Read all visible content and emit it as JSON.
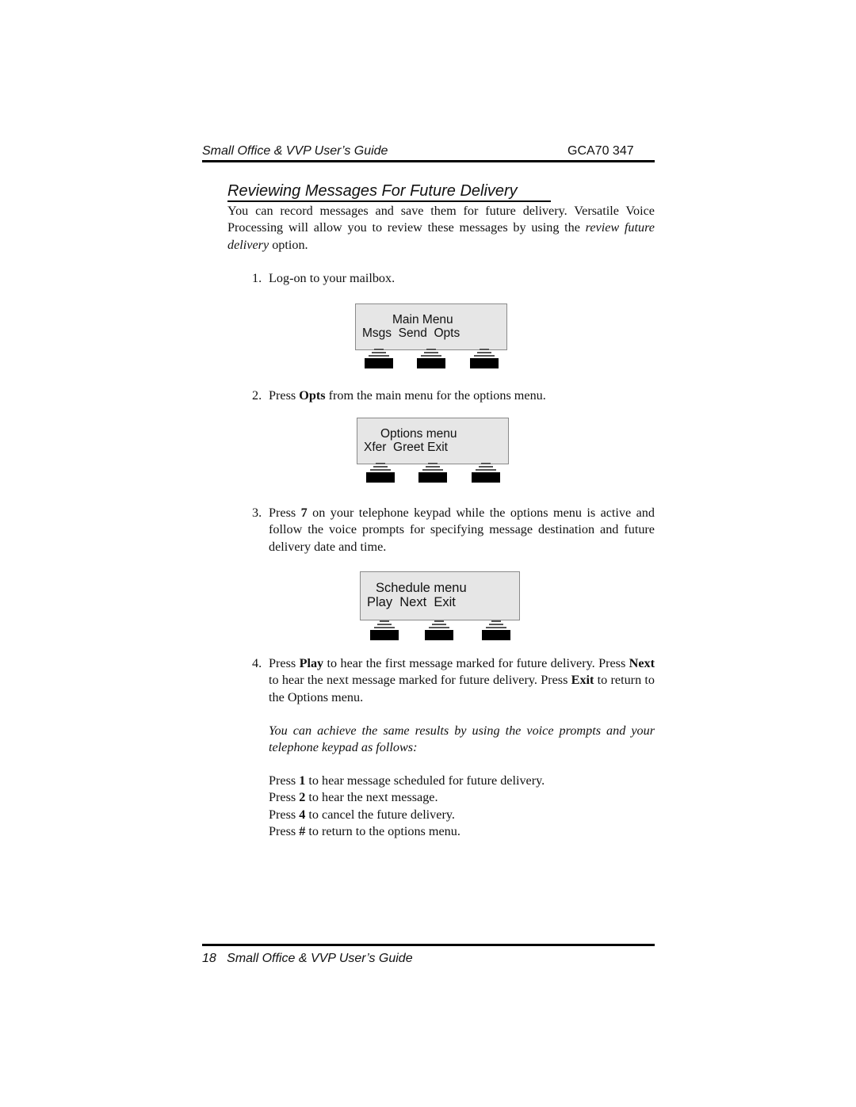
{
  "header": {
    "guide_title": "Small Office & VVP User’s Guide",
    "doc_code": "GCA70 347"
  },
  "section": {
    "title": "Reviewing Messages For Future Delivery"
  },
  "intro": {
    "text_before": "You can record messages and save them for future delivery. Versatile Voice Processing will allow you to review these messages by using the ",
    "emphasis": "review future delivery",
    "text_after": " option."
  },
  "steps": [
    {
      "num": "1.",
      "parts": [
        {
          "t": "Log-on to your mailbox.",
          "b": false
        }
      ]
    },
    {
      "num": "2.",
      "parts": [
        {
          "t": "Press ",
          "b": false
        },
        {
          "t": "Opts",
          "b": true
        },
        {
          "t": " from the main menu for the options menu.",
          "b": false
        }
      ]
    },
    {
      "num": "3.",
      "parts": [
        {
          "t": "Press ",
          "b": false
        },
        {
          "t": "7",
          "b": true
        },
        {
          "t": " on your telephone keypad while the options menu is active and follow the voice prompts for specifying message destination and future delivery date and time.",
          "b": false
        }
      ]
    },
    {
      "num": "4.",
      "parts": [
        {
          "t": "Press ",
          "b": false
        },
        {
          "t": "Play",
          "b": true
        },
        {
          "t": " to hear the first message marked for future delivery. Press ",
          "b": false
        },
        {
          "t": "Next",
          "b": true
        },
        {
          "t": " to hear the next message marked for future delivery. Press ",
          "b": false
        },
        {
          "t": "Exit",
          "b": true
        },
        {
          "t": " to return to the Options menu.",
          "b": false
        }
      ]
    }
  ],
  "displays": {
    "main_menu": {
      "line1": "Main Menu",
      "line2": "Msgs  Send  Opts",
      "softkeys": [
        "Msgs",
        "Send",
        "Opts"
      ]
    },
    "options_menu": {
      "line1": "Options menu",
      "line2": "Xfer  Greet Exit",
      "softkeys": [
        "Xfer",
        "Greet",
        "Exit"
      ]
    },
    "schedule_menu": {
      "line1": "Schedule menu",
      "line2": "Play  Next  Exit",
      "softkeys": [
        "Play",
        "Next",
        "Exit"
      ]
    }
  },
  "alt_note": "You can achieve the same results by using the voice prompts and your telephone keypad as follows:",
  "keypad_instructions": [
    {
      "prefix": "Press ",
      "key": "1",
      "suffix": " to hear message scheduled for future delivery."
    },
    {
      "prefix": "Press ",
      "key": "2",
      "suffix": " to hear the next message."
    },
    {
      "prefix": "Press ",
      "key": "4",
      "suffix": " to cancel the future delivery."
    },
    {
      "prefix": "Press ",
      "key": "#",
      "suffix": " to return to the options menu."
    }
  ],
  "footer": {
    "page_number": "18",
    "guide_title": "Small Office & VVP User’s Guide"
  }
}
